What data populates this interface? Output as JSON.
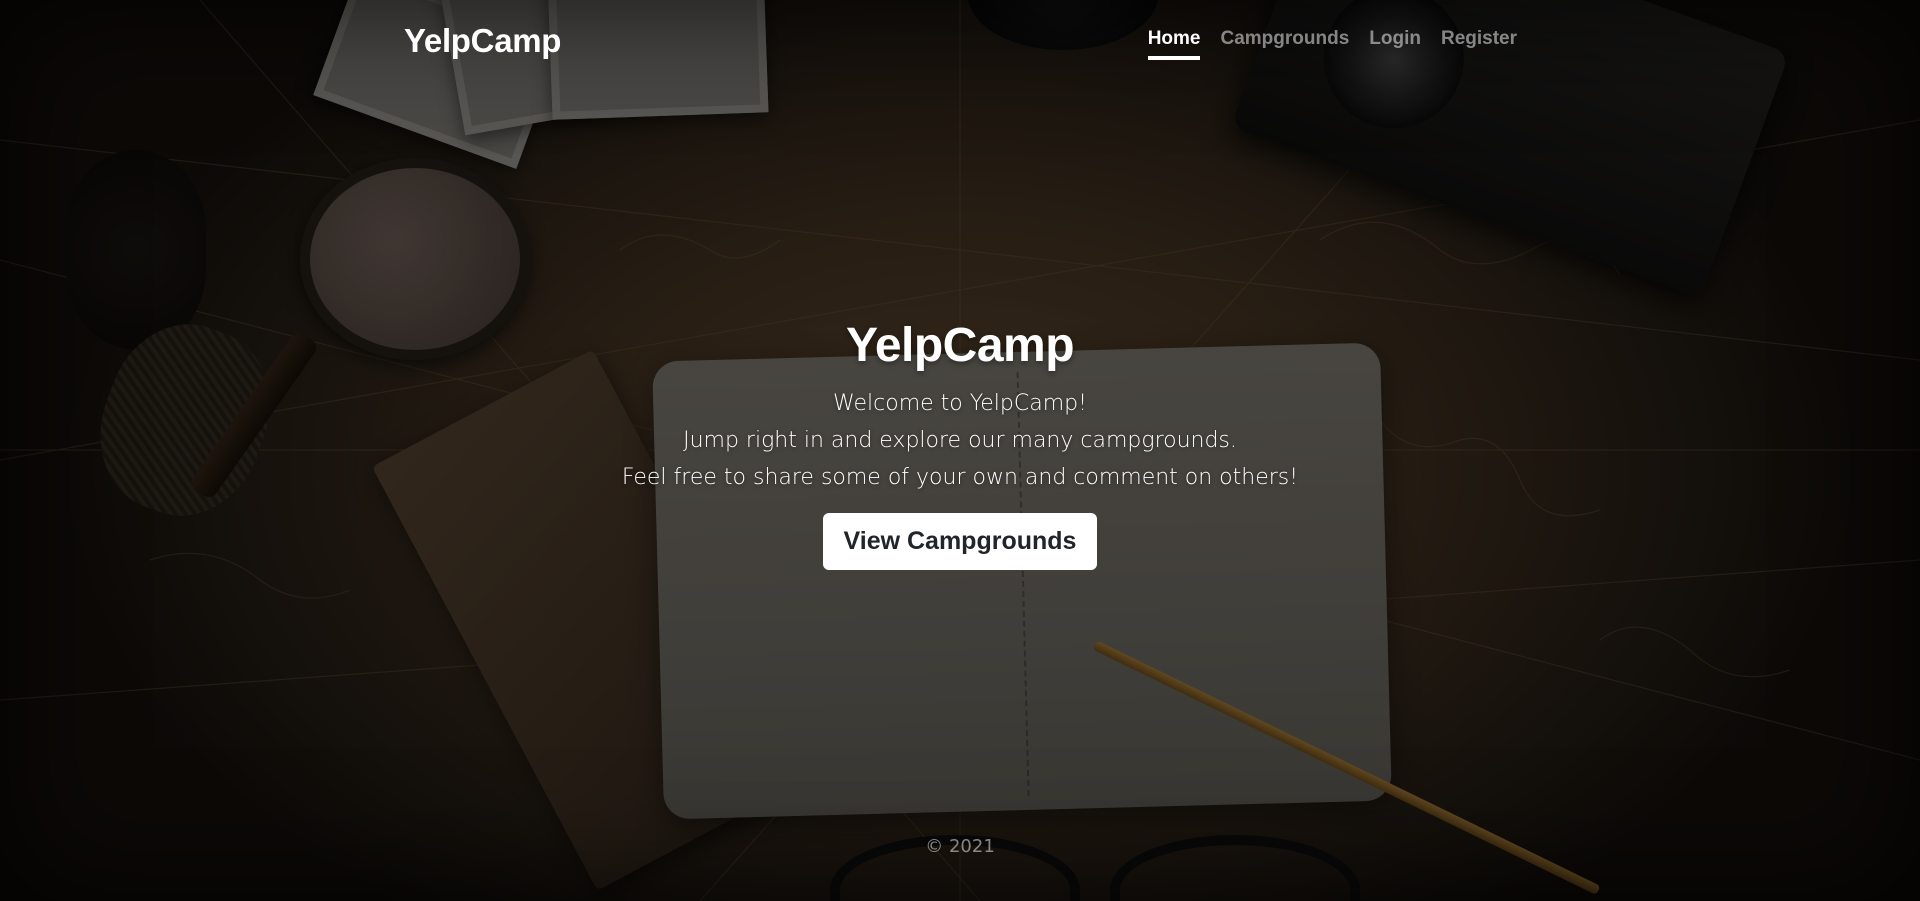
{
  "navbar": {
    "brand": "YelpCamp",
    "links": [
      {
        "label": "Home",
        "active": true
      },
      {
        "label": "Campgrounds",
        "active": false
      },
      {
        "label": "Login",
        "active": false
      },
      {
        "label": "Register",
        "active": false
      }
    ]
  },
  "hero": {
    "title": "YelpCamp",
    "lines": [
      "Welcome to YelpCamp!",
      "Jump right in and explore our many campgrounds.",
      "Feel free to share some of your own and comment on others!"
    ],
    "button_label": "View Campgrounds"
  },
  "footer": {
    "copyright": "© 2021"
  },
  "colors": {
    "text_primary": "#ffffff",
    "text_muted": "rgba(255,255,255,0.5)",
    "button_bg": "#ffffff",
    "button_text": "#212529",
    "overlay": "rgba(0,0,0,0.48)"
  }
}
